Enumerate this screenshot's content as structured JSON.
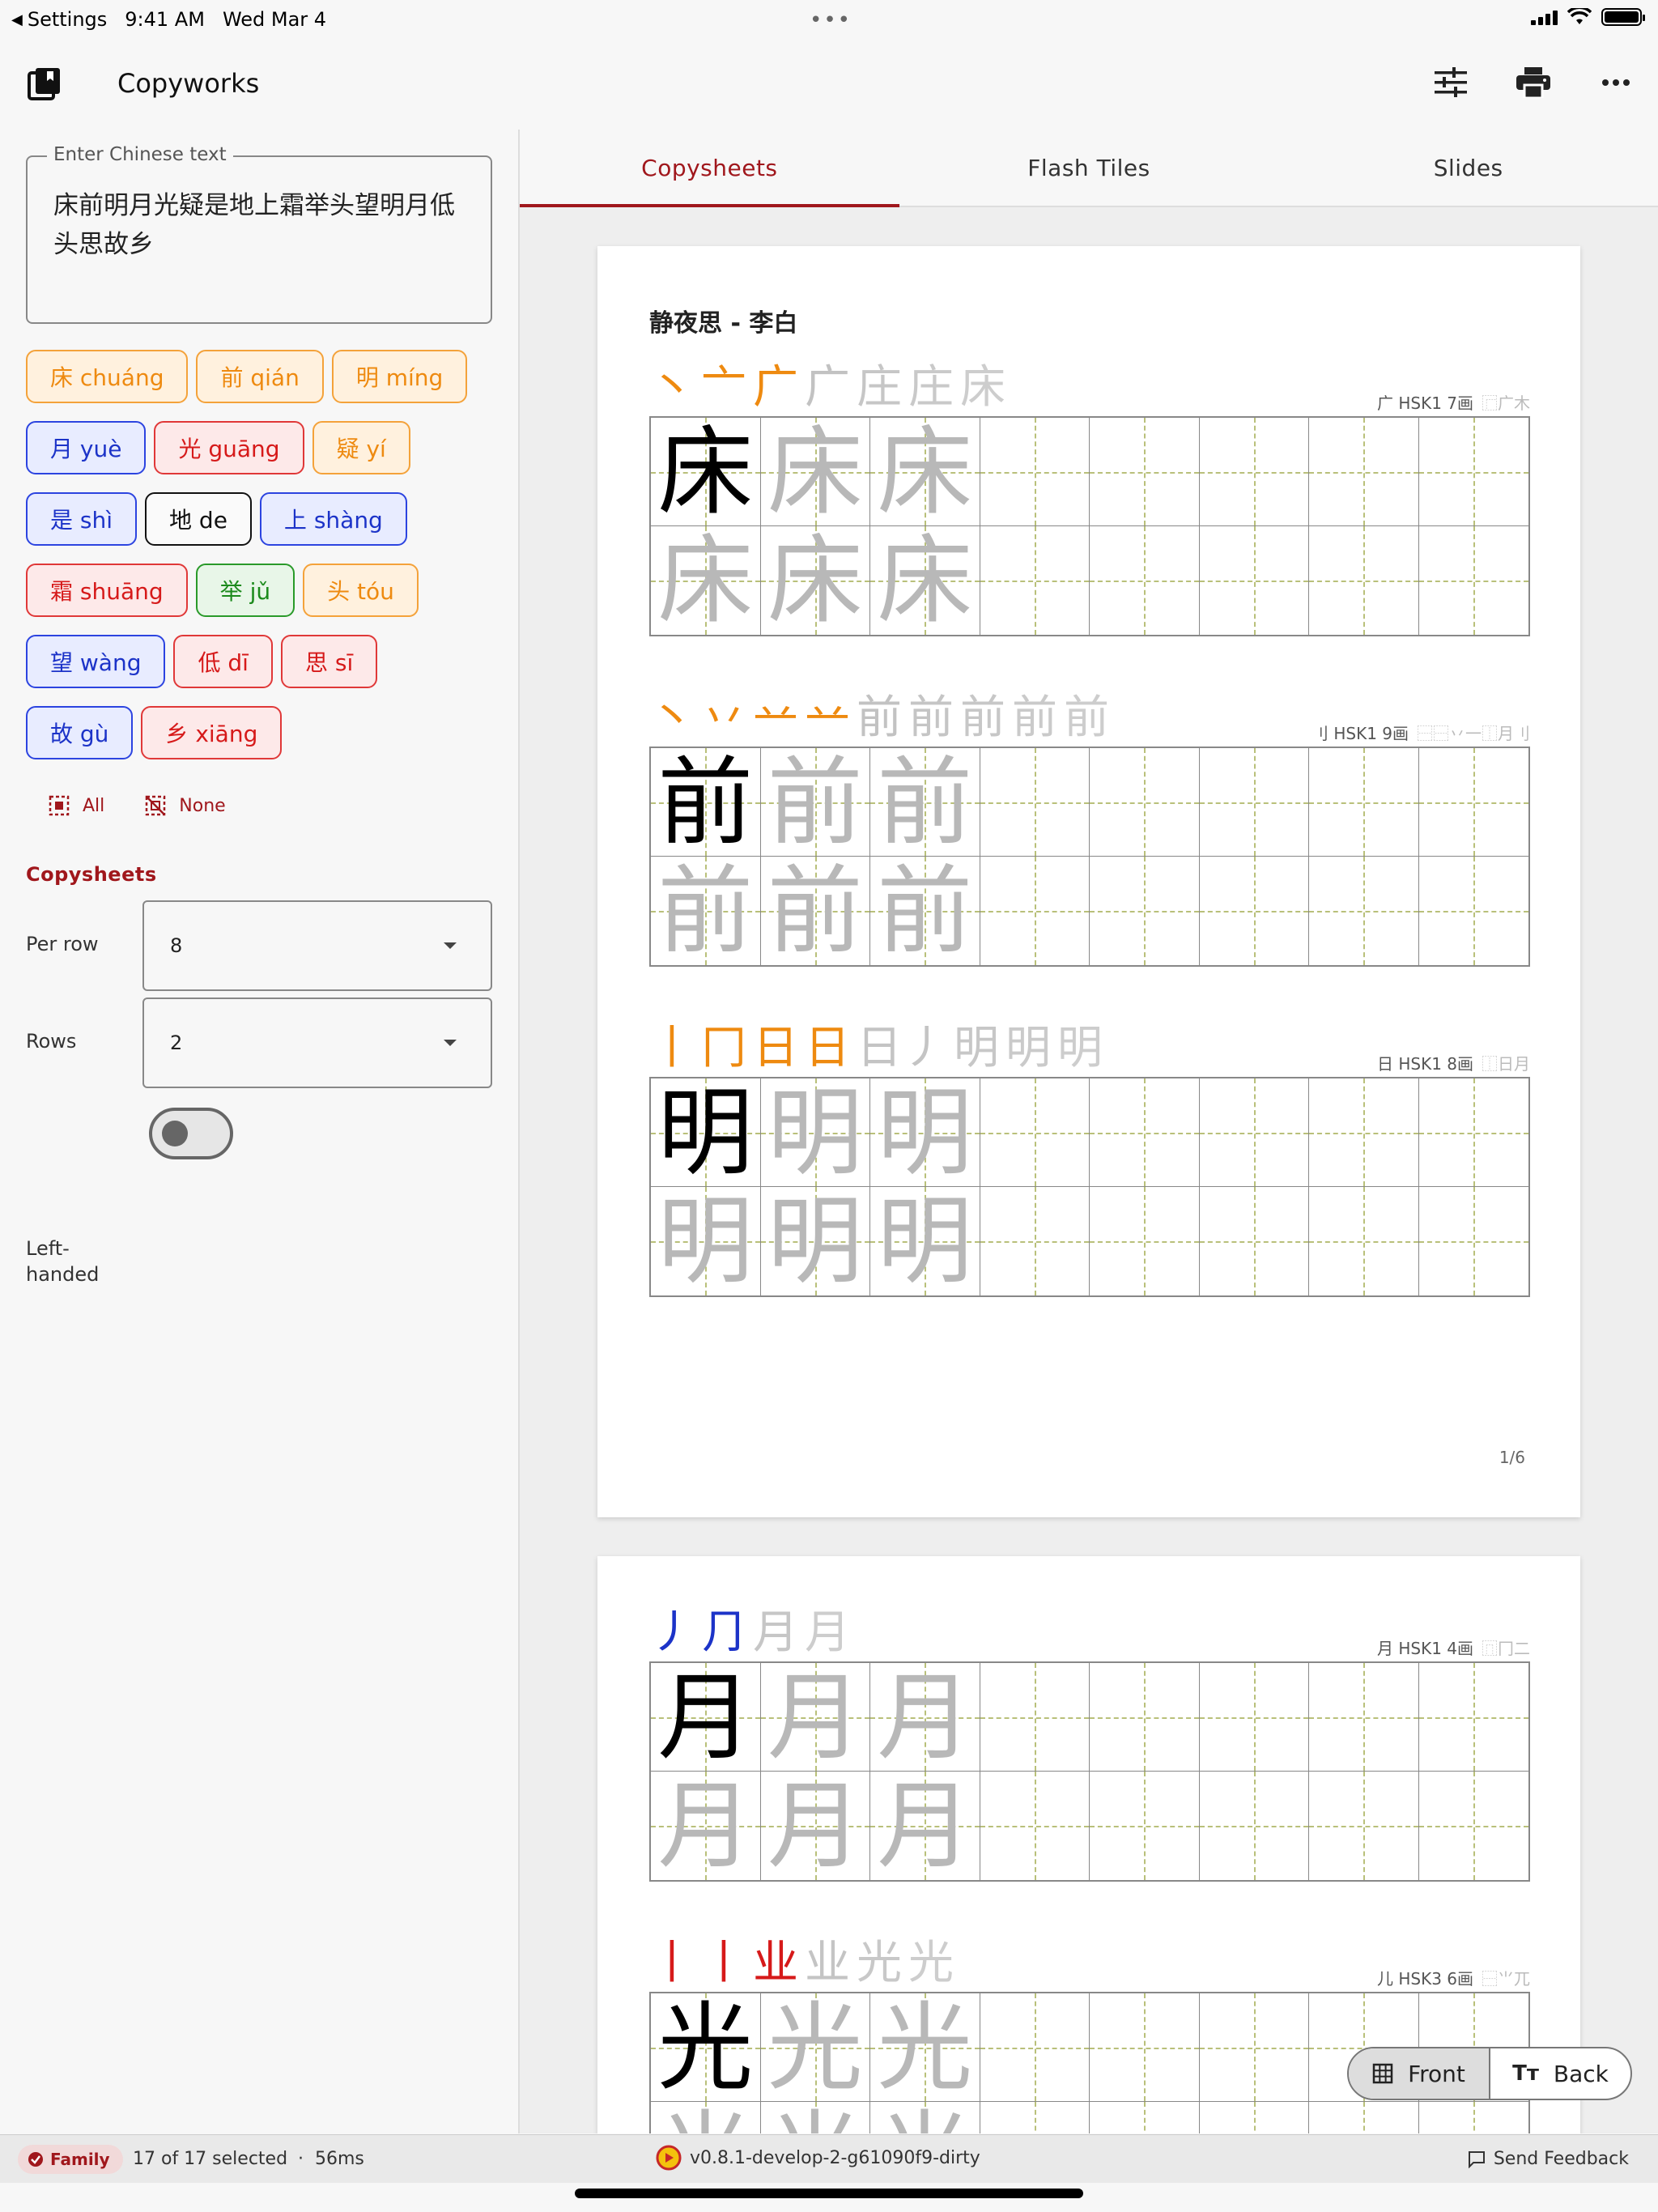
{
  "status_bar": {
    "back_label": "Settings",
    "time": "9:41 AM",
    "date": "Wed Mar 4"
  },
  "app": {
    "title": "Copyworks"
  },
  "input": {
    "label": "Enter Chinese text",
    "value": "床前明月光疑是地上霜举头望明月低头思故乡"
  },
  "chips": [
    [
      {
        "text": "床 chuáng",
        "color": "orange"
      },
      {
        "text": "前 qián",
        "color": "orange"
      },
      {
        "text": "明 míng",
        "color": "orange"
      }
    ],
    [
      {
        "text": "月 yuè",
        "color": "blue"
      },
      {
        "text": "光 guāng",
        "color": "red"
      },
      {
        "text": "疑 yí",
        "color": "orange"
      }
    ],
    [
      {
        "text": "是 shì",
        "color": "blue"
      },
      {
        "text": "地 de",
        "color": "black"
      },
      {
        "text": "上 shàng",
        "color": "blue"
      }
    ],
    [
      {
        "text": "霜 shuāng",
        "color": "red"
      },
      {
        "text": "举 jǔ",
        "color": "green"
      },
      {
        "text": "头 tóu",
        "color": "orange"
      }
    ],
    [
      {
        "text": "望 wàng",
        "color": "blue"
      },
      {
        "text": "低 dī",
        "color": "red"
      },
      {
        "text": "思 sī",
        "color": "red"
      }
    ],
    [
      {
        "text": "故 gù",
        "color": "blue"
      },
      {
        "text": "乡 xiāng",
        "color": "red"
      }
    ]
  ],
  "select": {
    "all_label": "All",
    "none_label": "None"
  },
  "settings": {
    "section_title": "Copysheets",
    "per_row_label": "Per row",
    "per_row_value": "8",
    "rows_label": "Rows",
    "rows_value": "2",
    "left_handed_label": "Left-handed"
  },
  "tabs": [
    {
      "label": "Copysheets",
      "active": true
    },
    {
      "label": "Flash Tiles",
      "active": false
    },
    {
      "label": "Slides",
      "active": false
    }
  ],
  "pages": [
    {
      "title": "静夜思 - 李白",
      "page_number": "1/6",
      "characters": [
        {
          "char": "床",
          "strokes": [
            "丶",
            "亠",
            "广",
            "广",
            "庄",
            "庄",
            "床"
          ],
          "stroke_color": "#ee8a10",
          "meta": "广  HSK1  7画",
          "decomp": "⿸广木"
        },
        {
          "char": "前",
          "strokes": [
            "丶",
            "丷",
            "䒑",
            "䒑",
            "前",
            "前",
            "前",
            "前",
            "前"
          ],
          "stroke_color": "#ee8a10",
          "meta": "刂  HSK1  9画",
          "decomp": "⿱⿱丷一⿰月刂"
        },
        {
          "char": "明",
          "strokes": [
            "丨",
            "冂",
            "日",
            "日",
            "日丿",
            "明",
            "明",
            "明"
          ],
          "stroke_color": "#ee8a10",
          "meta": "日  HSK1  8画",
          "decomp": "⿰日月"
        }
      ]
    },
    {
      "title": "",
      "page_number": "",
      "characters": [
        {
          "char": "月",
          "strokes": [
            "丿",
            "⺆",
            "月",
            "月"
          ],
          "stroke_color": "#1c33c8",
          "meta": "月  HSK1  4画",
          "decomp": "⿵冂二"
        },
        {
          "char": "光",
          "strokes": [
            "丨",
            "丨",
            "业",
            "业",
            "光",
            "光"
          ],
          "stroke_color": "#d61a1a",
          "meta": "儿  HSK3  6画",
          "decomp": "⿱⺌兀"
        }
      ]
    }
  ],
  "face_toggle": {
    "front_label": "Front",
    "back_label": "Back"
  },
  "footer": {
    "badge": "Family",
    "selected": "17 of 17 selected",
    "timing": "56ms",
    "version": "v0.8.1-develop-2-g61090f9-dirty",
    "feedback": "Send Feedback"
  },
  "colors": {
    "accent": "#a0171c",
    "orange": "#ee8a10",
    "blue": "#1c33c8",
    "red": "#d61a1a",
    "green": "#1c8a1c"
  }
}
